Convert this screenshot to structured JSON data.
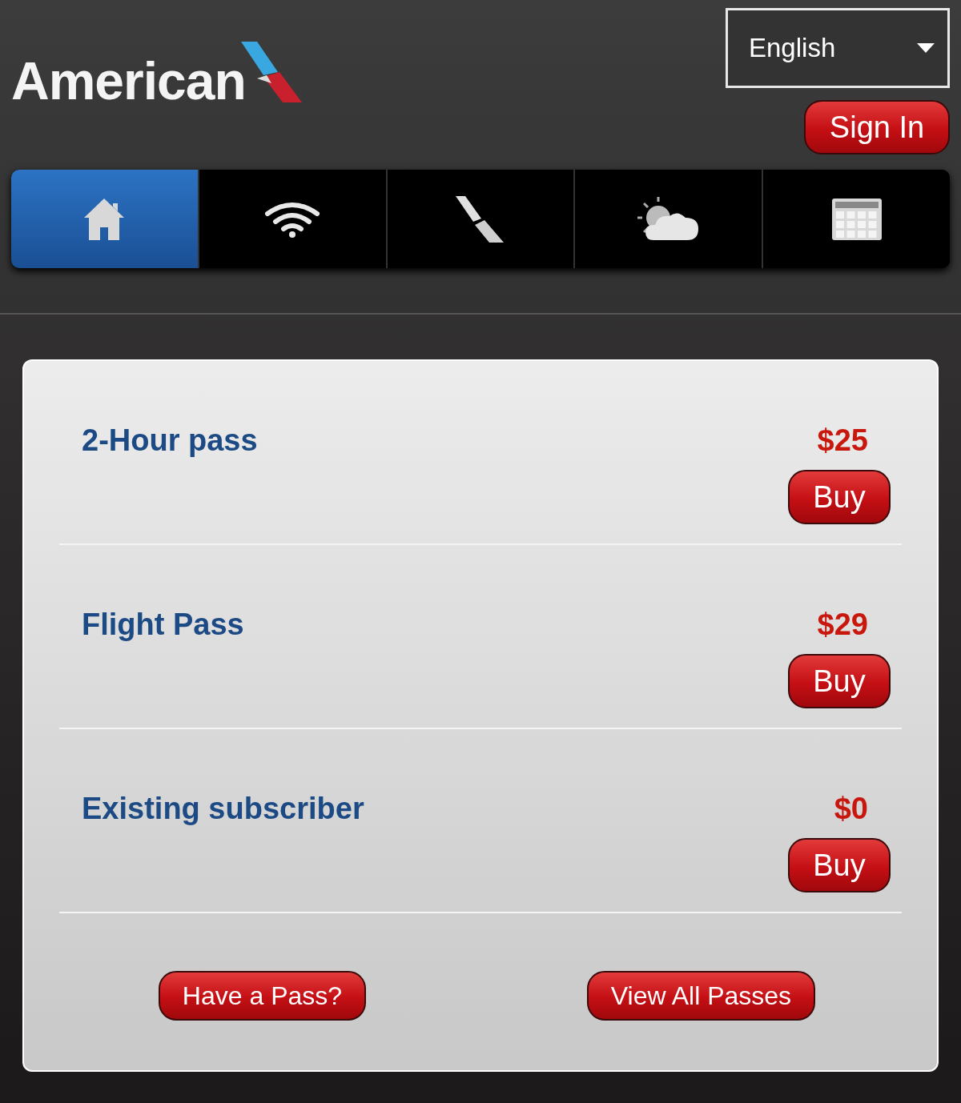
{
  "logo": {
    "text": "American"
  },
  "language": {
    "value": "English"
  },
  "sign_in": {
    "label": "Sign In"
  },
  "nav_tabs": [
    {
      "kind": "home",
      "selected": true
    },
    {
      "kind": "wifi",
      "selected": false
    },
    {
      "kind": "plane",
      "selected": false
    },
    {
      "kind": "weather",
      "selected": false
    },
    {
      "kind": "calendar",
      "selected": false
    }
  ],
  "passes": [
    {
      "name": "2-Hour pass",
      "price": "$25",
      "button": "Buy"
    },
    {
      "name": "Flight Pass",
      "price": "$29",
      "button": "Buy"
    },
    {
      "name": "Existing subscriber",
      "price": "$0",
      "button": "Buy"
    }
  ],
  "footer_buttons": [
    "Have a Pass?",
    "View All Passes"
  ]
}
